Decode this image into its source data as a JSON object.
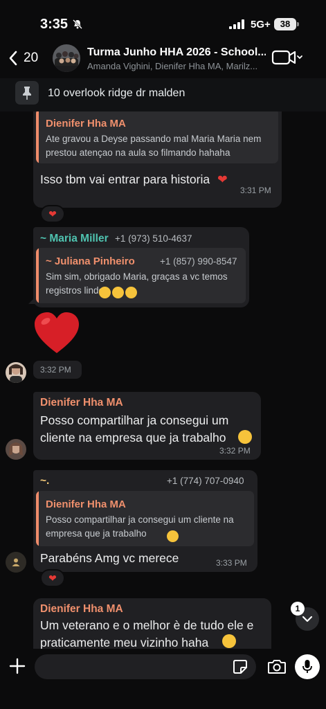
{
  "status_bar": {
    "time": "3:35",
    "network": "5G+",
    "battery": "38"
  },
  "header": {
    "back_count": "20",
    "title": "Turma Junho HHA 2026 - School...",
    "members": "Amanda Vighini, Dienifer Hha MA, Marilz..."
  },
  "pinned": {
    "text": "10 overlook ridge dr malden"
  },
  "messages": [
    {
      "quote_name": "Dienifer Hha MA",
      "quote_text": "Ate gravou a Deyse passando mal Maria Maria nem prestou atençao na aula so filmando hahaha",
      "text": "Isso tbm vai entrar para historia",
      "time": "3:31 PM",
      "reaction": "❤"
    },
    {
      "sender": "~ Maria Miller",
      "sender_phone": "+1 (973) 510-4637",
      "quote_name": "~ Juliana Pinheiro",
      "quote_phone": "+1 (857) 990-8547",
      "quote_text": "Sim sim, obrigado Maria, graças a vc temos registros lindos"
    },
    {
      "emoji": "❤",
      "time": "3:32 PM"
    },
    {
      "sender": "Dienifer Hha MA",
      "text": "Posso compartilhar ja consegui um cliente na empresa que ja trabalho",
      "time": "3:32 PM"
    },
    {
      "sender": "~.",
      "sender_phone": "+1 (774) 707-0940",
      "quote_name": "Dienifer Hha MA",
      "quote_text": "Posso compartilhar ja consegui um cliente na empresa que ja trabalho",
      "text": "Parabéns Amg vc merece",
      "time": "3:33 PM",
      "reaction": "❤"
    },
    {
      "sender": "Dienifer Hha MA",
      "text": "Um veterano e o melhor è de tudo ele e praticamente meu vizinho haha"
    }
  ],
  "scroll_badge": "1",
  "input": {
    "placeholder": ""
  },
  "colors": {
    "background": "#0b0b0c",
    "bubble": "#202023",
    "quote_accent": "#ef8c6b",
    "teal_sender": "#4fc3b0"
  },
  "icons": [
    "bell-slash-icon",
    "signal-icon",
    "back-chevron-icon",
    "video-icon",
    "pin-icon",
    "heart-icon",
    "chevron-down-icon",
    "plus-icon",
    "sticker-icon",
    "camera-icon",
    "mic-icon"
  ]
}
